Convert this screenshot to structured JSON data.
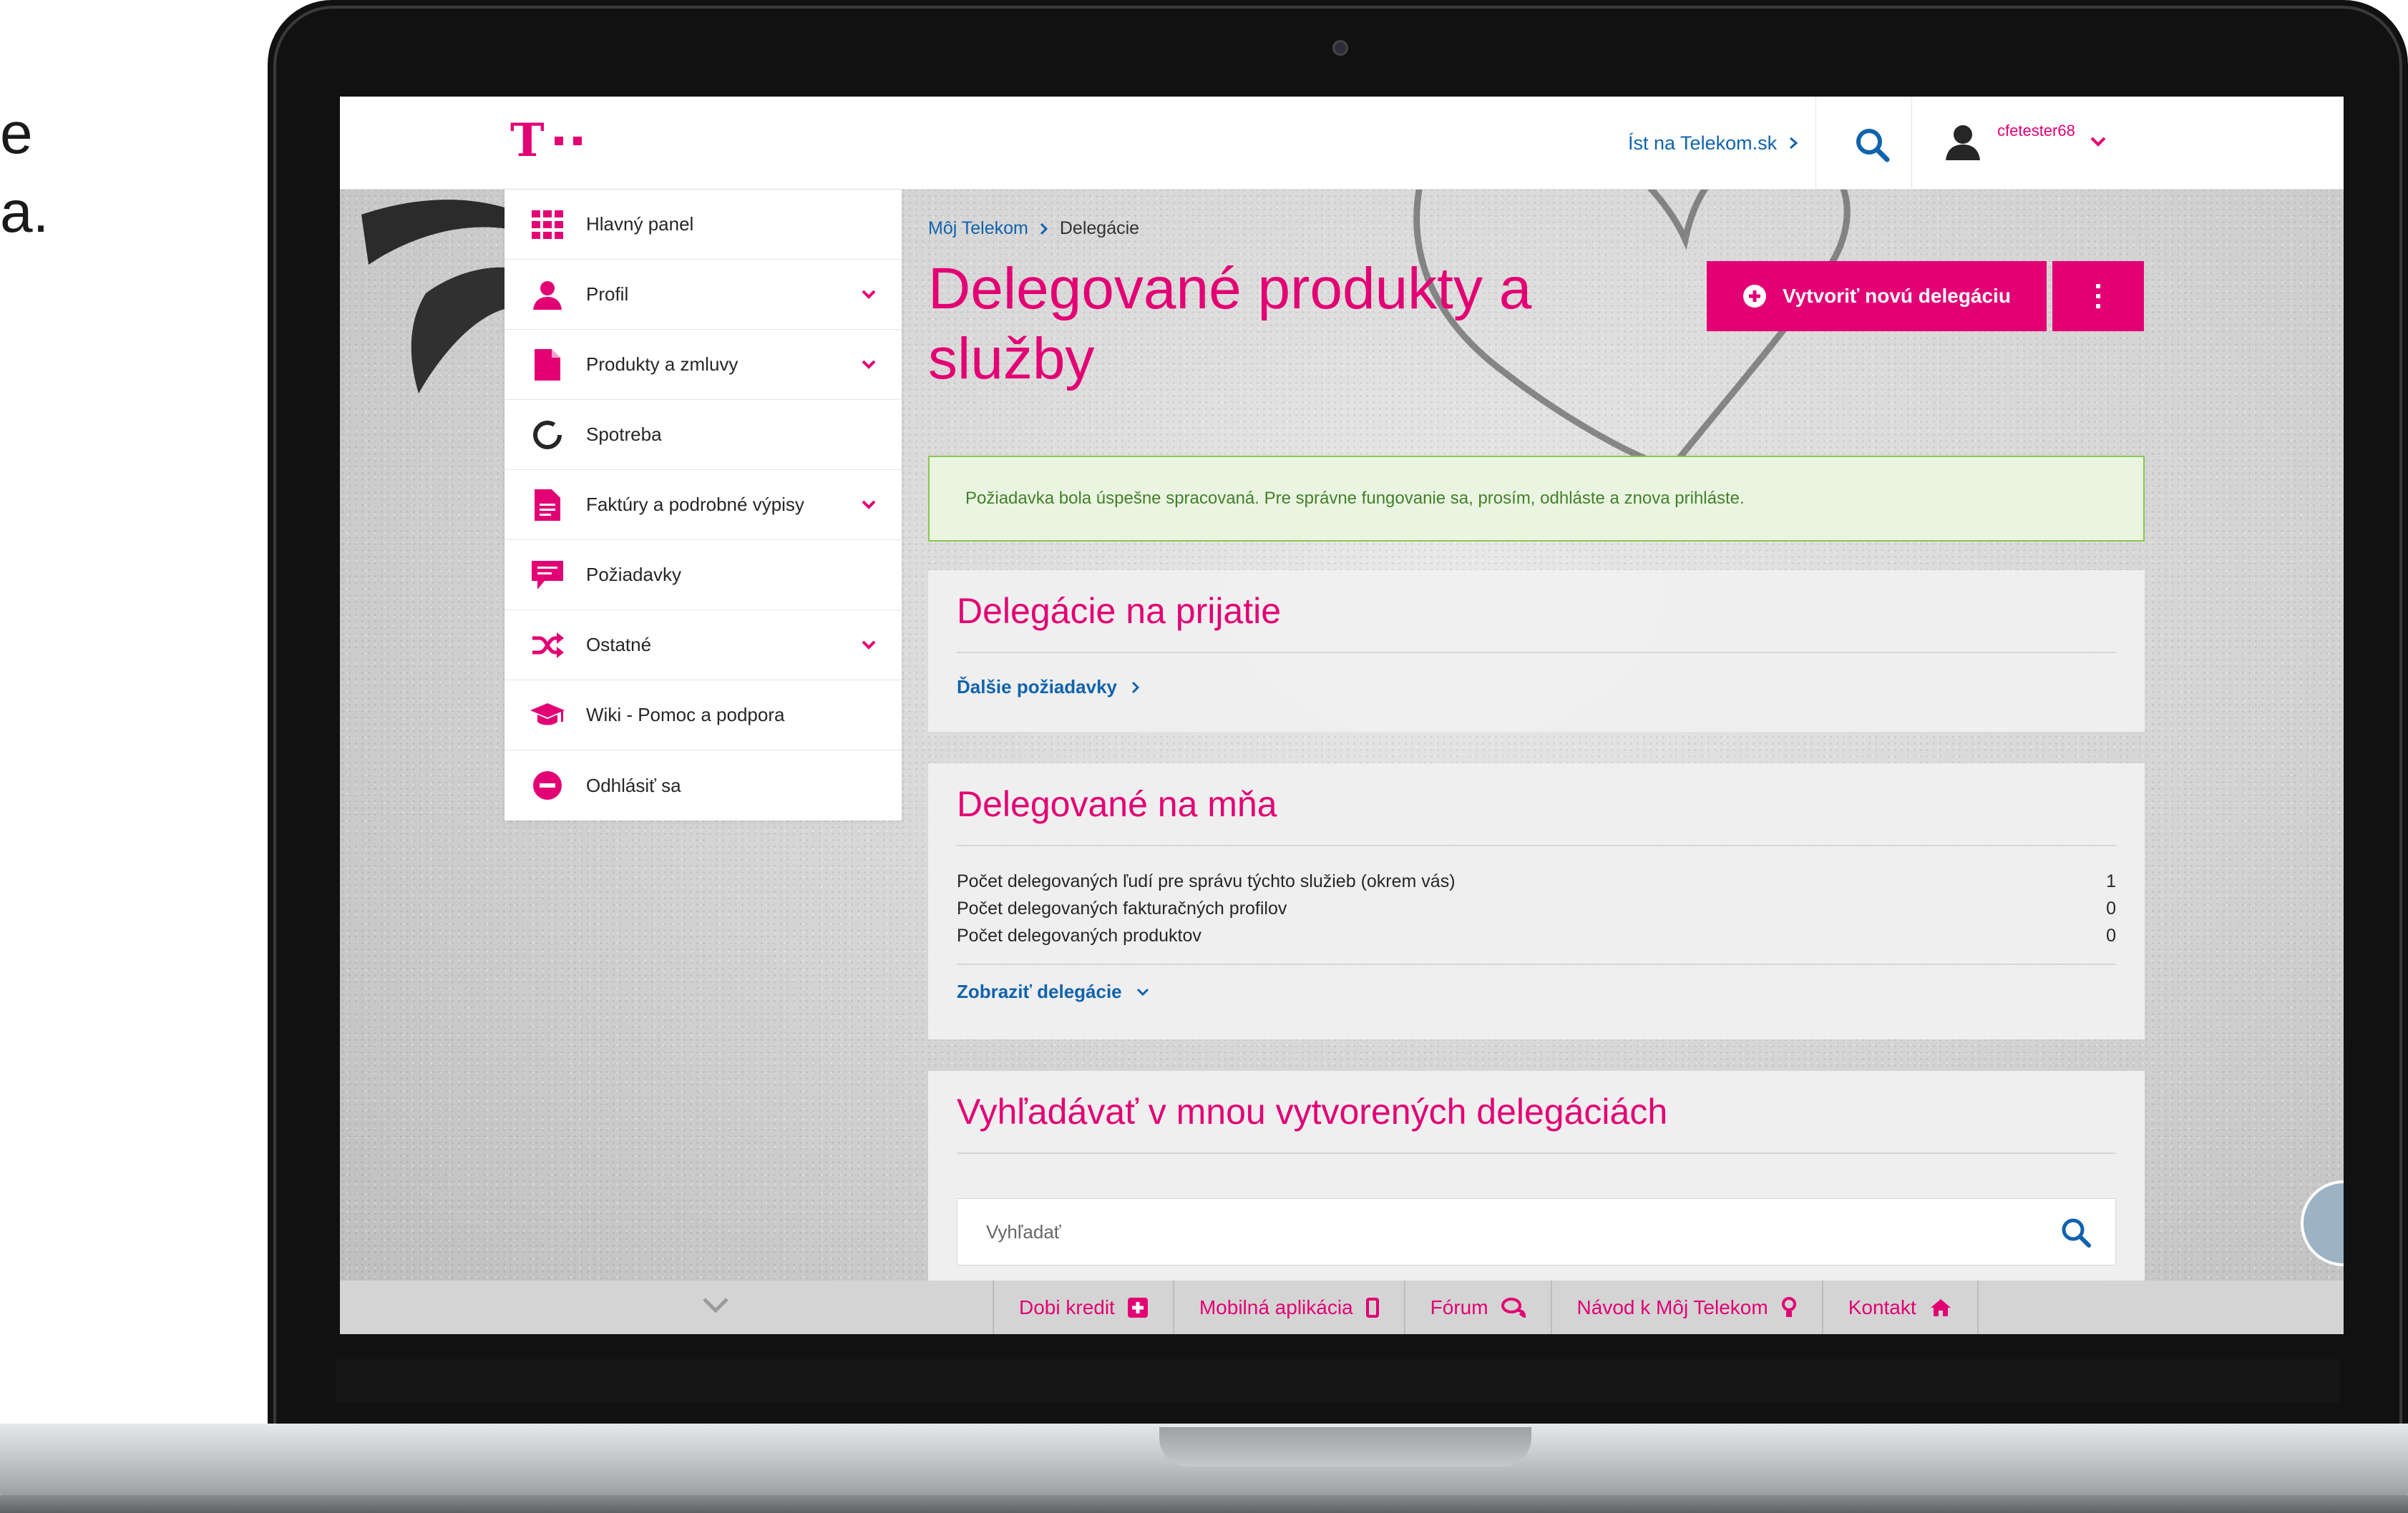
{
  "fragments": {
    "line1": "e",
    "line2": "a."
  },
  "topbar": {
    "go_to_link": "Íst na Telekom.sk",
    "username": "cfetester68"
  },
  "sidebar": {
    "items": [
      {
        "label": "Hlavný panel",
        "icon": "grid-icon",
        "has_chevron": false
      },
      {
        "label": "Profil",
        "icon": "user-icon",
        "has_chevron": true
      },
      {
        "label": "Produkty a zmluvy",
        "icon": "document-icon",
        "has_chevron": true
      },
      {
        "label": "Spotreba",
        "icon": "ring-icon",
        "has_chevron": false
      },
      {
        "label": "Faktúry a podrobné výpisy",
        "icon": "invoice-icon",
        "has_chevron": true
      },
      {
        "label": "Požiadavky",
        "icon": "speech-icon",
        "has_chevron": false
      },
      {
        "label": "Ostatné",
        "icon": "shuffle-icon",
        "has_chevron": true
      },
      {
        "label": "Wiki - Pomoc a podpora",
        "icon": "graduation-cap-icon",
        "has_chevron": false
      },
      {
        "label": "Odhlásiť sa",
        "icon": "minus-circle-icon",
        "has_chevron": false
      }
    ]
  },
  "main": {
    "breadcrumb": {
      "root": "Môj Telekom",
      "current": "Delegácie"
    },
    "title": "Delegované produkty a služby",
    "new_button": "Vytvoriť novú delegáciu",
    "alert": "Požiadavka bola úspešne spracovaná. Pre správne fungovanie sa, prosím, odhláste a znova prihláste.",
    "card_incoming": {
      "title": "Delegácie na prijatie",
      "link": "Ďalšie požiadavky"
    },
    "card_delegated": {
      "title": "Delegované na mňa",
      "rows": [
        {
          "label": "Počet delegovaných ľudí pre správu týchto služieb (okrem vás)",
          "value": "1"
        },
        {
          "label": "Počet delegovaných fakturačných profilov",
          "value": "0"
        },
        {
          "label": "Počet delegovaných produktov",
          "value": "0"
        }
      ],
      "link": "Zobraziť delegácie"
    },
    "card_search": {
      "title": "Vyhľadávať v mnou vytvorených delegáciách",
      "placeholder": "Vyhľadať"
    }
  },
  "footer": {
    "items": [
      {
        "label": "Dobi kredit",
        "icon": "plus-square-icon"
      },
      {
        "label": "Mobilná aplikácia",
        "icon": "phone-icon"
      },
      {
        "label": "Fórum",
        "icon": "chat-icon"
      },
      {
        "label": "Návod k Môj Telekom",
        "icon": "lightbulb-icon"
      },
      {
        "label": "Kontakt",
        "icon": "home-icon"
      }
    ]
  },
  "colors": {
    "brand": "#e20074",
    "link": "#1063ad",
    "success_bg": "#eaf5e1",
    "success_text": "#43802b"
  }
}
